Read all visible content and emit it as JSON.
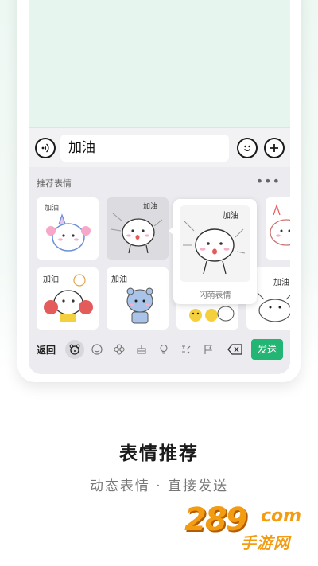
{
  "input_bar": {
    "message_text": "加油",
    "voice_icon": "voice-icon",
    "emoji_icon": "emoji-icon",
    "add_icon": "add-icon"
  },
  "panel": {
    "title": "推荐表情",
    "more_icon": "more-dots-icon",
    "more_glyph": "•••",
    "preview_label": "闪萌表情",
    "stickers": [
      {
        "caption": "加油"
      },
      {
        "caption": "加油"
      },
      {
        "caption": "加油"
      },
      {
        "caption": "加油"
      },
      {
        "caption": "加油"
      },
      {
        "caption": "加油"
      },
      {
        "caption": "加油!!"
      }
    ]
  },
  "toolbar": {
    "back_label": "返回",
    "send_label": "发送",
    "icons": [
      "bear-face-icon",
      "smile-icon",
      "flower-icon",
      "cake-icon",
      "bulb-icon",
      "symbols-icon",
      "flag-icon",
      "backspace-icon"
    ]
  },
  "promo": {
    "headline": "表情推荐",
    "subline": "动态表情 · 直接发送"
  },
  "watermark": {
    "number": "289",
    "domain": "com",
    "brand": "手游网"
  },
  "colors": {
    "accent": "#22b573",
    "chat_bg": "#e6f6ee",
    "watermark": "#f39c12"
  }
}
